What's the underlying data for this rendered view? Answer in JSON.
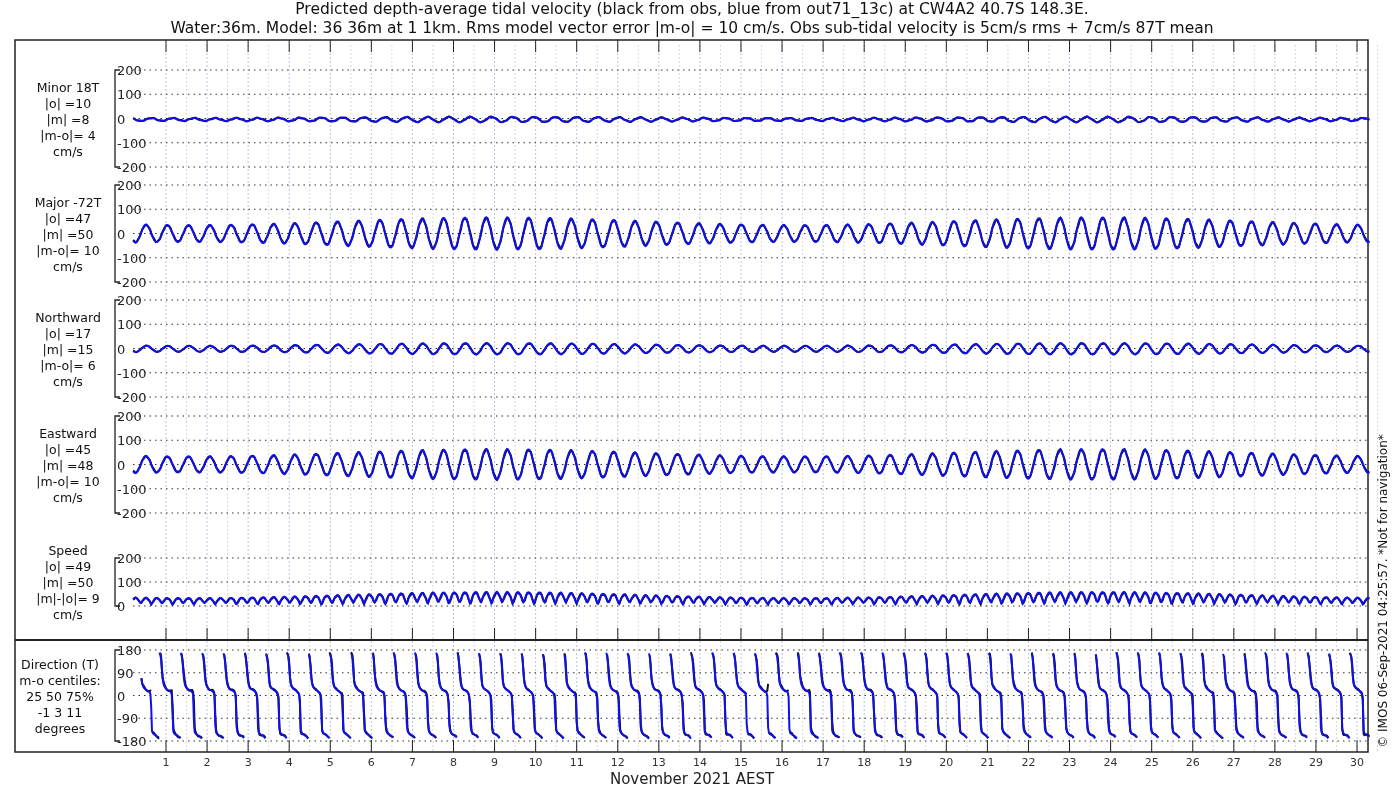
{
  "title": [
    "Predicted depth-average tidal velocity (black from obs, blue from out71_13c) at CW4A2 40.7S 148.3E.",
    "Water:36m. Model: 36 36m at 1 1km. Rms model vector error |m-o| = 10 cm/s. Obs sub-tidal velocity is 5cm/s rms + 7cm/s 87T mean"
  ],
  "panels": [
    {
      "kind": "velocity",
      "label": [
        "Minor 18T",
        "|o| =10",
        "|m| =8",
        "|m-o|= 4",
        "cm/s"
      ],
      "yticks": [
        "200",
        "100",
        "0",
        "-100",
        "-200"
      ]
    },
    {
      "kind": "velocity",
      "label": [
        "Major -72T",
        "|o| =47",
        "|m| =50",
        "|m-o|= 10",
        "cm/s"
      ],
      "yticks": [
        "200",
        "100",
        "0",
        "-100",
        "-200"
      ]
    },
    {
      "kind": "velocity",
      "label": [
        "Northward",
        "|o| =17",
        "|m| =15",
        "|m-o|= 6",
        "cm/s"
      ],
      "yticks": [
        "200",
        "100",
        "0",
        "-100",
        "-200"
      ]
    },
    {
      "kind": "velocity",
      "label": [
        "Eastward",
        "|o| =45",
        "|m| =48",
        "|m-o|= 10",
        "cm/s"
      ],
      "yticks": [
        "200",
        "100",
        "0",
        "-100",
        "-200"
      ]
    },
    {
      "kind": "speed",
      "label": [
        "Speed",
        "|o| =49",
        "|m| =50",
        "|m|-|o|= 9",
        "cm/s"
      ],
      "yticks": [
        "200",
        "100",
        "0"
      ]
    },
    {
      "kind": "direction",
      "label": [
        "Direction (T)",
        "m-o centiles:",
        "25  50  75%",
        "-1   3  11",
        "degrees"
      ],
      "yticks": [
        "180",
        "90",
        "0",
        "-90",
        "-180"
      ]
    }
  ],
  "xticks": [
    "1",
    "2",
    "3",
    "4",
    "5",
    "6",
    "7",
    "8",
    "9",
    "10",
    "11",
    "12",
    "13",
    "14",
    "15",
    "16",
    "17",
    "18",
    "19",
    "20",
    "21",
    "22",
    "23",
    "24",
    "25",
    "26",
    "27",
    "28",
    "29",
    "30"
  ],
  "xlabel": "November 2021 AEST",
  "credit": "© IMOS 06-Sep-2021 04:25:57. *Not for navigation*"
}
